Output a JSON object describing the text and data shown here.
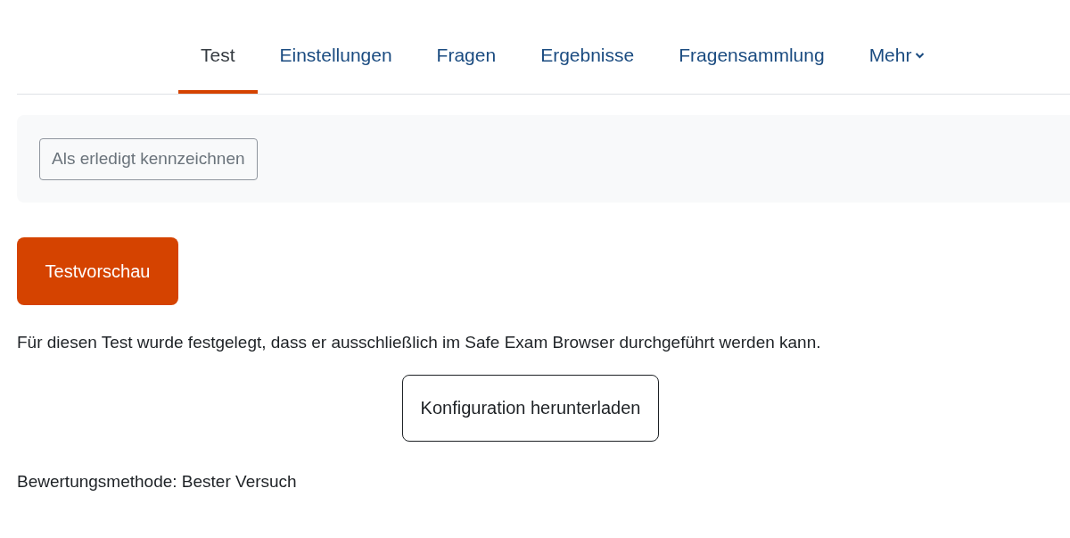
{
  "tabs": [
    {
      "label": "Test",
      "selected": true,
      "dropdown": false
    },
    {
      "label": "Einstellungen",
      "selected": false,
      "dropdown": false
    },
    {
      "label": "Fragen",
      "selected": false,
      "dropdown": false
    },
    {
      "label": "Ergebnisse",
      "selected": false,
      "dropdown": false
    },
    {
      "label": "Fragensammlung",
      "selected": false,
      "dropdown": false
    },
    {
      "label": "Mehr",
      "selected": false,
      "dropdown": true
    }
  ],
  "completion_button": "Als erledigt kennzeichnen",
  "preview_button": "Testvorschau",
  "notice": "Für diesen Test wurde festgelegt, dass er ausschließlich im Safe Exam Browser durchgeführt werden kann.",
  "download_button": "Konfiguration herunterladen",
  "grading_method": "Bewertungsmethode: Bester Versuch"
}
